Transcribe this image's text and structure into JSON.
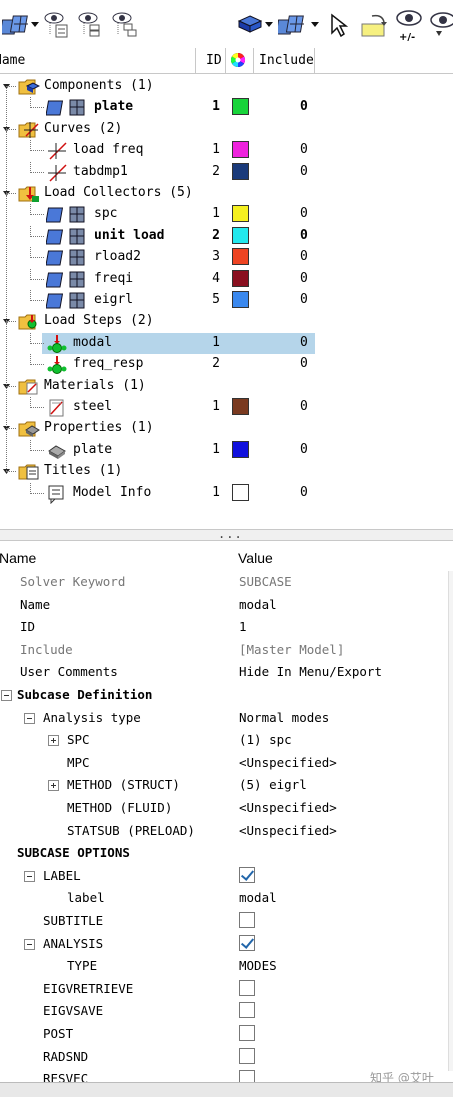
{
  "toolbar": {
    "icons": [
      "entity-view-icon",
      "dropdown-arrow-icon",
      "show-icon",
      "hide-icon",
      "isolate-icon",
      "component-color-icon",
      "dropdown-arrow-icon",
      "collector-view-icon",
      "dropdown-arrow-icon",
      "select-cursor-icon",
      "reset-view-icon",
      "show-hide-toggle-icon",
      "isolate-only-icon"
    ],
    "plus_minus": "+/-"
  },
  "tree_header": {
    "name": "Name",
    "id": "ID",
    "include": "Include"
  },
  "tree": [
    {
      "type": "folder",
      "label": "Components (1)"
    },
    {
      "type": "item",
      "label": "plate",
      "id": "1",
      "include": "0",
      "color": "#18d43a",
      "bold": true
    },
    {
      "type": "folder",
      "label": "Curves (2)"
    },
    {
      "type": "item",
      "label": "load freq",
      "id": "1",
      "include": "0",
      "color": "#ee22dd"
    },
    {
      "type": "item",
      "label": "tabdmp1",
      "id": "2",
      "include": "0",
      "color": "#1a3a7a"
    },
    {
      "type": "folder",
      "label": "Load Collectors (5)"
    },
    {
      "type": "item",
      "label": "spc",
      "id": "1",
      "include": "0",
      "color": "#f5f020"
    },
    {
      "type": "item",
      "label": "unit load",
      "id": "2",
      "include": "0",
      "color": "#22e8ee",
      "bold": true
    },
    {
      "type": "item",
      "label": "rload2",
      "id": "3",
      "include": "0",
      "color": "#ee4422"
    },
    {
      "type": "item",
      "label": "freqi",
      "id": "4",
      "include": "0",
      "color": "#8a1020"
    },
    {
      "type": "item",
      "label": "eigrl",
      "id": "5",
      "include": "0",
      "color": "#3a88ee"
    },
    {
      "type": "folder",
      "label": "Load Steps (2)"
    },
    {
      "type": "item",
      "label": "modal",
      "id": "1",
      "include": "0",
      "selected": true
    },
    {
      "type": "item",
      "label": "freq_resp",
      "id": "2",
      "include": "0"
    },
    {
      "type": "folder",
      "label": "Materials (1)"
    },
    {
      "type": "item",
      "label": "steel",
      "id": "1",
      "include": "0",
      "color": "#7a3a20"
    },
    {
      "type": "folder",
      "label": "Properties (1)"
    },
    {
      "type": "item",
      "label": "plate",
      "id": "1",
      "include": "0",
      "color": "#1010dd"
    },
    {
      "type": "folder",
      "label": "Titles (1)"
    },
    {
      "type": "item",
      "label": "Model Info",
      "id": "1",
      "include": "0",
      "color": "#ffffff"
    }
  ],
  "splitter": "...",
  "props_header": {
    "name": "Name",
    "value": "Value"
  },
  "props": [
    {
      "name": "Solver Keyword",
      "value": "SUBCASE",
      "gray": true
    },
    {
      "name": "Name",
      "value": "modal"
    },
    {
      "name": "ID",
      "value": "1"
    },
    {
      "name": "Include",
      "value": "[Master Model]",
      "gray": true
    },
    {
      "name": "User Comments",
      "value": "Hide In Menu/Export"
    },
    {
      "name": "Subcase Definition",
      "section": true
    },
    {
      "name": "Analysis type",
      "value": "Normal modes"
    },
    {
      "name": "SPC",
      "value": "(1) spc"
    },
    {
      "name": "MPC",
      "value": "<Unspecified>"
    },
    {
      "name": "METHOD (STRUCT)",
      "value": "(5) eigrl"
    },
    {
      "name": "METHOD (FLUID)",
      "value": "<Unspecified>"
    },
    {
      "name": "STATSUB (PRELOAD)",
      "value": "<Unspecified>"
    },
    {
      "name": "SUBCASE OPTIONS",
      "section": true
    },
    {
      "name": "LABEL",
      "checked": true
    },
    {
      "name": "label",
      "value": "modal"
    },
    {
      "name": "SUBTITLE",
      "checked": false
    },
    {
      "name": "ANALYSIS",
      "checked": true
    },
    {
      "name": "TYPE",
      "value": "MODES"
    },
    {
      "name": "EIGVRETRIEVE",
      "checked": false
    },
    {
      "name": "EIGVSAVE",
      "checked": false
    },
    {
      "name": "POST",
      "checked": false
    },
    {
      "name": "RADSND",
      "checked": false
    },
    {
      "name": "RESVEC",
      "checked": false
    }
  ],
  "watermark": "知乎 @艾叶"
}
